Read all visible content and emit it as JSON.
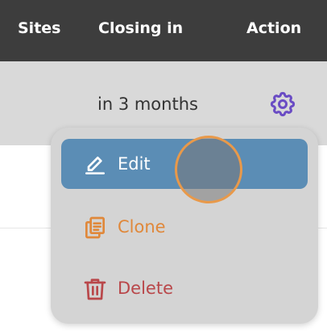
{
  "table": {
    "headers": [
      "Sites",
      "Closing in",
      "Action"
    ],
    "row": {
      "closing_in": "in 3 months",
      "action_icon": "gear-icon"
    }
  },
  "menu": {
    "items": [
      {
        "label": "Edit",
        "icon": "pencil-icon",
        "color": "#ffffff",
        "background": "#5b8db5",
        "highlighted": true
      },
      {
        "label": "Clone",
        "icon": "copy-icon",
        "color": "#e0883a"
      },
      {
        "label": "Delete",
        "icon": "trash-icon",
        "color": "#b9474a"
      }
    ]
  },
  "colors": {
    "header_bg": "#3d3d3d",
    "row_bg": "#d9d9d9",
    "gear": "#6a4cc4",
    "cursor_ring": "#e8994a"
  }
}
